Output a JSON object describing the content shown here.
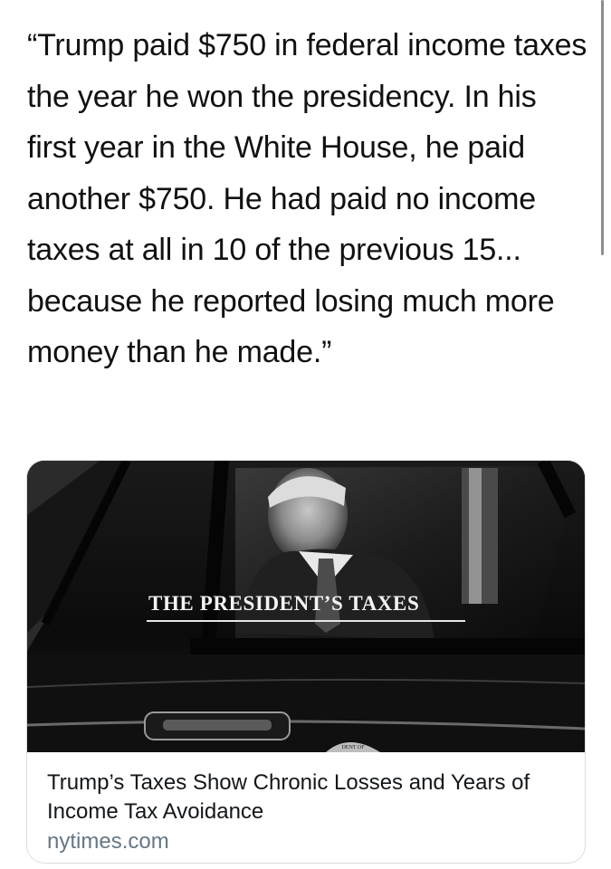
{
  "tweet": {
    "text": "“Trump paid $750 in federal income taxes the year he won the presidency. In his first year in the White House, he paid another $750. He had paid no income taxes at all in 10 of the previous 15... because he reported losing much more money than he made.”"
  },
  "link_card": {
    "image_caption": "THE PRESIDENT’S TAXES",
    "image_seal_text": "DENT OF",
    "title": "Trump’s Taxes Show Chronic Losses and Years of Income Tax Avoidance",
    "domain": "nytimes.com"
  }
}
